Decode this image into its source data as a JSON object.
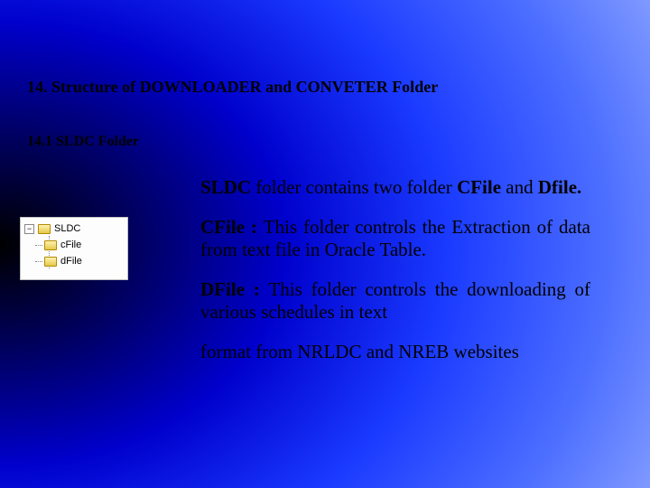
{
  "heading": "14.  Structure of DOWNLOADER and CONVETER Folder",
  "subheading": "14.1 SLDC Folder",
  "tree": {
    "toggle": "−",
    "root": "SLDC",
    "children": [
      "cFile",
      "dFile"
    ]
  },
  "paragraphs": {
    "p1_bold_a": "SLDC",
    "p1_text_a": " folder contains two folder ",
    "p1_bold_b": "CFile",
    "p1_text_b": " and ",
    "p1_bold_c": "Dfile.",
    "p2_bold": "CFile : ",
    "p2_text": "This folder controls the Extraction of data from text file in Oracle Table.",
    "p3_bold": "DFile : ",
    "p3_text": "This folder controls the downloading of various schedules in text",
    "p4_text": "format from NRLDC and NREB websites"
  }
}
